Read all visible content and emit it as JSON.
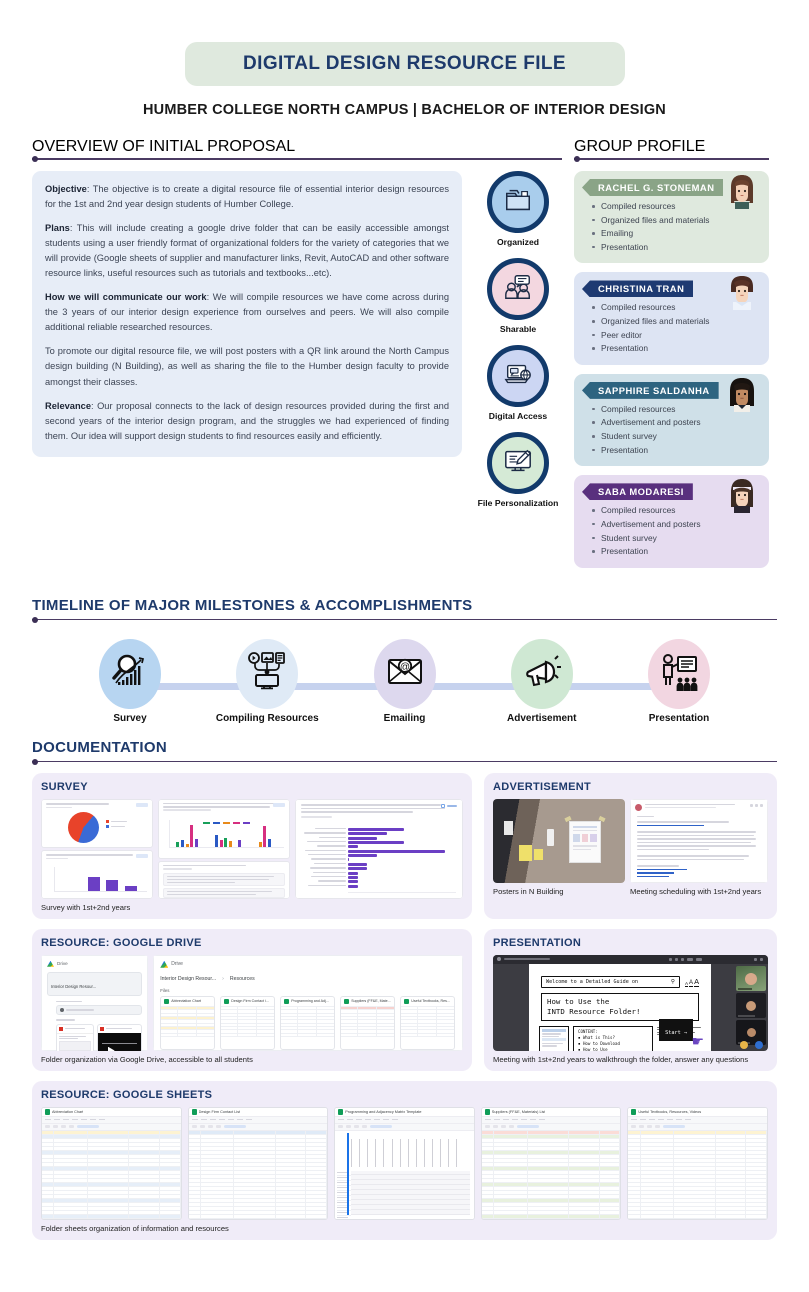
{
  "header": {
    "title": "DIGITAL DESIGN RESOURCE FILE",
    "subtitle": "HUMBER COLLEGE NORTH CAMPUS | BACHELOR OF INTERIOR DESIGN",
    "title_pill_color": "#dfe9de",
    "title_text_color": "#1e3a6b"
  },
  "sections": {
    "overview": "OVERVIEW OF INITIAL PROPOSAL",
    "group_profile": "GROUP PROFILE",
    "timeline": "TIMELINE OF MAJOR MILESTONES & ACCOMPLISHMENTS",
    "documentation": "DOCUMENTATION"
  },
  "proposal": {
    "background": "#e7edf7",
    "paragraphs": [
      {
        "lead": "Objective",
        "text": ": The objective is to create a digital resource file of essential interior design resources for the 1st and 2nd year design students of Humber College."
      },
      {
        "lead": "Plans",
        "text": ": This will include creating a google drive folder that can be easily accessible amongst students using a user friendly format of organizational folders for the variety of categories that we will provide (Google sheets of supplier and manufacturer links, Revit, AutoCAD and other software resource links, useful resources such as tutorials and textbooks...etc)."
      },
      {
        "lead": "How we will communicate our work",
        "text": ": We will compile resources we have come across during the 3 years of our interior design experience from ourselves and peers. We will also compile additional reliable researched resources."
      },
      {
        "lead": "",
        "text": "To promote our digital resource file, we will post posters with a QR link around the North Campus design building (N Building), as well as sharing the file to the Humber design faculty to provide amongst their classes."
      },
      {
        "lead": "Relevance",
        "text": ": Our proposal connects to the lack of design resources provided during the first and second years of the interior design program, and the struggles we had experienced of finding them. Our idea will support design students to find resources easily and efficiently."
      }
    ]
  },
  "features": [
    {
      "label": "Organized",
      "icon": "folder-icon",
      "ring_color": "#123a6b",
      "fill": "#a9cdec"
    },
    {
      "label": "Sharable",
      "icon": "people-chat-icon",
      "ring_color": "#123a6b",
      "fill": "#f3d7e0"
    },
    {
      "label": "Digital Access",
      "icon": "laptop-globe-icon",
      "ring_color": "#123a6b",
      "fill": "#ccd6f3"
    },
    {
      "label": "File Personalization",
      "icon": "monitor-pencil-icon",
      "ring_color": "#123a6b",
      "fill": "#d5ead6"
    }
  ],
  "group": [
    {
      "name": "RACHEL G. STONEMAN",
      "card_bg": "#dfe9de",
      "banner_color": "#8aa487",
      "avatar": "avatar-rachel",
      "tasks": [
        "Compiled resources",
        "Organized files and materials",
        "Emailing",
        "Presentation"
      ]
    },
    {
      "name": "CHRISTINA TRAN",
      "card_bg": "#dde4f3",
      "banner_color": "#1e3a72",
      "avatar": "avatar-christina",
      "tasks": [
        "Compiled resources",
        "Organized files and materials",
        "Peer editor",
        "Presentation"
      ]
    },
    {
      "name": "SAPPHIRE SALDANHA",
      "card_bg": "#cfe0e8",
      "banner_color": "#2e6480",
      "avatar": "avatar-sapphire",
      "tasks": [
        "Compiled resources",
        "Advertisement and posters",
        "Student survey",
        "Presentation"
      ]
    },
    {
      "name": "SABA MODARESI",
      "card_bg": "#e6dcf0",
      "banner_color": "#59307e",
      "avatar": "avatar-saba",
      "tasks": [
        "Compiled resources",
        "Advertisement and posters",
        "Student survey",
        "Presentation"
      ]
    }
  ],
  "timeline": {
    "line_color": "#c6d2ee",
    "steps": [
      {
        "label": "Survey",
        "icon": "magnifier-growth-chart-icon",
        "bubble": "#b7d5f1"
      },
      {
        "label": "Compiling Resources",
        "icon": "monitor-media-collect-icon",
        "bubble": "#dfeaf6"
      },
      {
        "label": "Emailing",
        "icon": "envelope-at-icon",
        "bubble": "#ddd8ee"
      },
      {
        "label": "Advertisement",
        "icon": "megaphone-icon",
        "bubble": "#cfe8d3"
      },
      {
        "label": "Presentation",
        "icon": "presenter-audience-icon",
        "bubble": "#f2d6e1"
      }
    ]
  },
  "documentation": {
    "card_bg": "#f0ecf8",
    "survey": {
      "title": "SURVEY",
      "caption": "Survey with 1st+2nd years",
      "shots": [
        "survey-pie-and-bar-chart",
        "survey-grouped-bar-chart",
        "survey-horizontal-bar-chart"
      ]
    },
    "advertisement": {
      "title": "ADVERTISEMENT",
      "captions": [
        "Posters in N Building",
        "Meeting scheduling with 1st+2nd years"
      ],
      "shots": [
        "poster-photo-n-building",
        "gmail-meeting-email"
      ]
    },
    "google_drive": {
      "title": "RESOURCE: GOOGLE DRIVE",
      "caption": "Folder organization via Google Drive, accessible to all students",
      "sidebar_label": "Drive",
      "folder_label": "Interior Design Resour...",
      "breadcrumb": [
        "Interior Design Resour...",
        "Resources"
      ],
      "files_label": "Files",
      "folders_label": "Folders",
      "files": [
        "Abbreviation Chart",
        "Design Firm Contact i...",
        "Programming and Adj...",
        "Suppliers (FF&E, Mate...",
        "Useful Textbooks, Res..."
      ]
    },
    "presentation": {
      "title": "PRESENTATION",
      "caption": "Meeting with 1st+2nd years to walkthrough the folder, answer any questions",
      "slide_search": "Welcome to a Detailed Guide on",
      "slide_heading_1": "How to Use the",
      "slide_heading_2": "INTD Resource Folder!",
      "slide_content_label": "CONTENT:",
      "slide_content_items": [
        "What is This?",
        "How to Download",
        "How to Use"
      ],
      "slide_button": "Start →"
    },
    "google_sheets": {
      "title": "RESOURCE: GOOGLE SHEETS",
      "caption": "Folder sheets organization of information and resources",
      "sheets": [
        "Abbreviation Chart",
        "Design Firm Contact List",
        "Programming and Adjacency Matrix Template",
        "Suppliers (FF&E, Materials) List",
        "Useful Textbooks, Resources, Videos"
      ]
    }
  },
  "chart_data": [
    {
      "type": "pie",
      "title": "What year are you currently in?",
      "labels": [
        "1st year",
        "2nd year"
      ],
      "values": [
        58,
        42
      ],
      "colors": [
        "#e8432a",
        "#3a6ad6"
      ]
    },
    {
      "type": "bar",
      "title": "How helpful were the resources provided during your first two design years?",
      "categories": [
        "1",
        "2",
        "3",
        "4",
        "5"
      ],
      "values": [
        0,
        0,
        7,
        5,
        2
      ],
      "ylabel": "responses",
      "color": "#6b3fc4"
    },
    {
      "type": "bar",
      "title": "Are there any particular skills or knowledge gaps you've encountered during projects that could be addressed through additional educational resources? If so, in what specific areas would you like to see covered? Choose all that applies.",
      "orientation": "horizontal",
      "responses_note": "11 responses",
      "categories": [
        "AutoCAD & Revit",
        "Rendering (Digital & Traditional)",
        "Space Planning",
        "RCP/Reflected Ceiling Plans",
        "Sections & Elevations",
        "Working Drawing & Detailing",
        "Diagramming (Bubble Diagrams)",
        "Design strategies and typologies",
        "Finding certified consultants",
        "Finding supplier/manufacturer",
        "Finding precedent research",
        "Understanding codes (Audit)",
        "Learning similar programs",
        "Business standards and org"
      ],
      "values": [
        6,
        4,
        3,
        6,
        1,
        10,
        3,
        0,
        2,
        2,
        1,
        1,
        1,
        1
      ],
      "data_labels": [
        "6 (54 %)",
        "4 (36.4%)",
        "3 (27.3%)",
        "6 (54 %)",
        "1 (9.1%)",
        "10 (90.9%)",
        "3 (27.3%)",
        "0 (0%)",
        "2 (18.2%)",
        "2 (18.2%)",
        "1 (9.1%)",
        "1 (9.1%)",
        "1 (9.1%)",
        "1 (9.1%)"
      ],
      "xlim": [
        0,
        10
      ],
      "color": "#6b3fc4"
    }
  ]
}
